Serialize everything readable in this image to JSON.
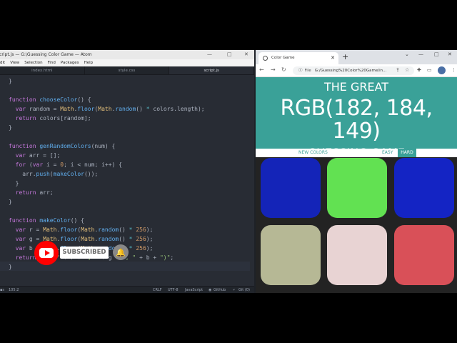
{
  "editor": {
    "title": "script.js — G:\\Guessing Color Game — Atom",
    "menu": [
      "dit",
      "View",
      "Selection",
      "Find",
      "Packages",
      "Help"
    ],
    "tabs": [
      "index.html",
      "style.css",
      "script.js"
    ],
    "status": {
      "position": "105:2",
      "line_ending": "CRLF",
      "encoding": "UTF-8",
      "grammar": "JavaScript",
      "github": "GitHub",
      "git": "Git (0)"
    }
  },
  "overlay": {
    "subscribe_label": "SUBSCRIBED"
  },
  "browser": {
    "tab_title": "Color Game",
    "url_prefix": "File",
    "url": "G:/Guessing%20Color%20Game/in..."
  },
  "game": {
    "title_top": "THE GREAT",
    "rgb_display": "RGB(182, 184, 149)",
    "title_bottom": "GUESSING GAME",
    "new_colors": "NEW COLORS",
    "easy": "EASY",
    "hard": "HARD",
    "squares": [
      "#1424b8",
      "#62e152",
      "#1424c4",
      "#b6b895",
      "#e8d3d3",
      "#d95058"
    ],
    "header_color": "#3aa198"
  }
}
